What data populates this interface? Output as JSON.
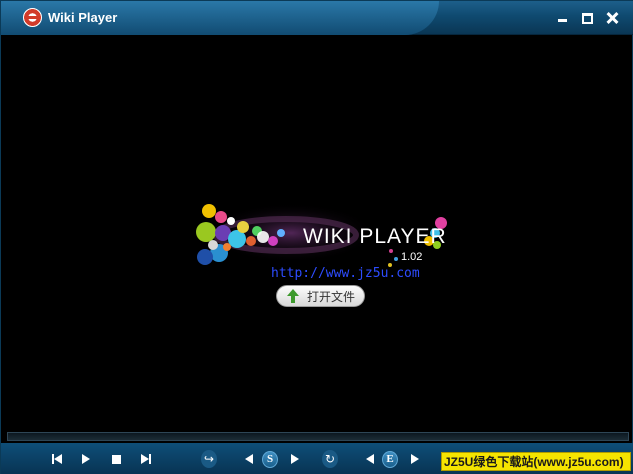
{
  "window": {
    "title": "Wiki Player"
  },
  "video": {
    "logo_name": "WIKI PLAYER",
    "logo_version": "1.02",
    "url": "http://www.jz5u.com",
    "open_file_label": "打开文件"
  },
  "watermark": {
    "text": "JZ5U绿色下载站(www.jz5u.com)"
  },
  "controls": {
    "subtitle_letter": "S",
    "effect_letter": "E"
  },
  "colors": {
    "titlebar": "#0f4a70",
    "controlbar": "#0b406a",
    "accent": "#2d4cff",
    "watermark": "#f5e400"
  }
}
